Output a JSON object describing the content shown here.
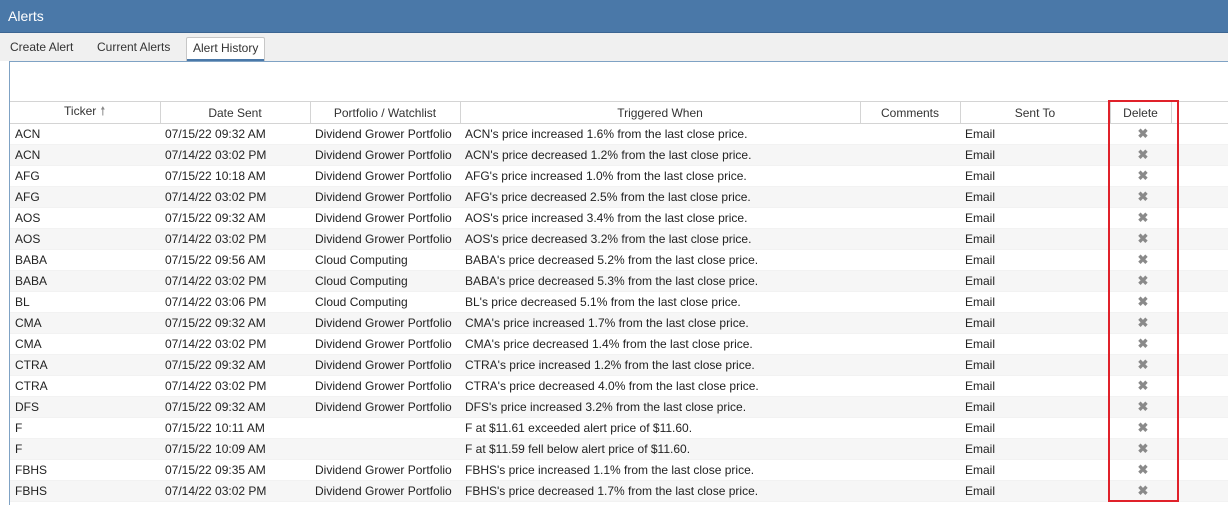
{
  "window": {
    "title": "Alerts"
  },
  "tabs": [
    {
      "label": "Create Alert"
    },
    {
      "label": "Current Alerts"
    },
    {
      "label": "Alert History"
    }
  ],
  "table": {
    "columns": [
      "Ticker",
      "Date Sent",
      "Portfolio / Watchlist",
      "Triggered When",
      "Comments",
      "Sent To",
      "Delete"
    ],
    "sort_icon": "arrow-up-icon",
    "delete_icon": "close-icon",
    "rows": [
      {
        "ticker": "ACN",
        "date": "07/15/22 09:32 AM",
        "portfolio": "Dividend Grower Portfolio",
        "triggered": "ACN's price increased 1.6% from the last close price.",
        "comments": "",
        "sent_to": "Email"
      },
      {
        "ticker": "ACN",
        "date": "07/14/22 03:02 PM",
        "portfolio": "Dividend Grower Portfolio",
        "triggered": "ACN's price decreased 1.2% from the last close price.",
        "comments": "",
        "sent_to": "Email"
      },
      {
        "ticker": "AFG",
        "date": "07/15/22 10:18 AM",
        "portfolio": "Dividend Grower Portfolio",
        "triggered": "AFG's price increased 1.0% from the last close price.",
        "comments": "",
        "sent_to": "Email"
      },
      {
        "ticker": "AFG",
        "date": "07/14/22 03:02 PM",
        "portfolio": "Dividend Grower Portfolio",
        "triggered": "AFG's price decreased 2.5% from the last close price.",
        "comments": "",
        "sent_to": "Email"
      },
      {
        "ticker": "AOS",
        "date": "07/15/22 09:32 AM",
        "portfolio": "Dividend Grower Portfolio",
        "triggered": "AOS's price increased 3.4% from the last close price.",
        "comments": "",
        "sent_to": "Email"
      },
      {
        "ticker": "AOS",
        "date": "07/14/22 03:02 PM",
        "portfolio": "Dividend Grower Portfolio",
        "triggered": "AOS's price decreased 3.2% from the last close price.",
        "comments": "",
        "sent_to": "Email"
      },
      {
        "ticker": "BABA",
        "date": "07/15/22 09:56 AM",
        "portfolio": "Cloud Computing",
        "triggered": "BABA's price decreased 5.2% from the last close price.",
        "comments": "",
        "sent_to": "Email"
      },
      {
        "ticker": "BABA",
        "date": "07/14/22 03:02 PM",
        "portfolio": "Cloud Computing",
        "triggered": "BABA's price decreased 5.3% from the last close price.",
        "comments": "",
        "sent_to": "Email"
      },
      {
        "ticker": "BL",
        "date": "07/14/22 03:06 PM",
        "portfolio": "Cloud Computing",
        "triggered": "BL's price decreased 5.1% from the last close price.",
        "comments": "",
        "sent_to": "Email"
      },
      {
        "ticker": "CMA",
        "date": "07/15/22 09:32 AM",
        "portfolio": "Dividend Grower Portfolio",
        "triggered": "CMA's price increased 1.7% from the last close price.",
        "comments": "",
        "sent_to": "Email"
      },
      {
        "ticker": "CMA",
        "date": "07/14/22 03:02 PM",
        "portfolio": "Dividend Grower Portfolio",
        "triggered": "CMA's price decreased 1.4% from the last close price.",
        "comments": "",
        "sent_to": "Email"
      },
      {
        "ticker": "CTRA",
        "date": "07/15/22 09:32 AM",
        "portfolio": "Dividend Grower Portfolio",
        "triggered": "CTRA's price increased 1.2% from the last close price.",
        "comments": "",
        "sent_to": "Email"
      },
      {
        "ticker": "CTRA",
        "date": "07/14/22 03:02 PM",
        "portfolio": "Dividend Grower Portfolio",
        "triggered": "CTRA's price decreased 4.0% from the last close price.",
        "comments": "",
        "sent_to": "Email"
      },
      {
        "ticker": "DFS",
        "date": "07/15/22 09:32 AM",
        "portfolio": "Dividend Grower Portfolio",
        "triggered": "DFS's price increased 3.2% from the last close price.",
        "comments": "",
        "sent_to": "Email"
      },
      {
        "ticker": "F",
        "date": "07/15/22 10:11 AM",
        "portfolio": "",
        "triggered": "F at $11.61 exceeded alert price of $11.60.",
        "comments": "",
        "sent_to": "Email"
      },
      {
        "ticker": "F",
        "date": "07/15/22 10:09 AM",
        "portfolio": "",
        "triggered": "F at $11.59 fell below alert price of $11.60.",
        "comments": "",
        "sent_to": "Email"
      },
      {
        "ticker": "FBHS",
        "date": "07/15/22 09:35 AM",
        "portfolio": "Dividend Grower Portfolio",
        "triggered": "FBHS's price increased 1.1% from the last close price.",
        "comments": "",
        "sent_to": "Email"
      },
      {
        "ticker": "FBHS",
        "date": "07/14/22 03:02 PM",
        "portfolio": "Dividend Grower Portfolio",
        "triggered": "FBHS's price decreased 1.7% from the last close price.",
        "comments": "",
        "sent_to": "Email"
      }
    ]
  },
  "highlight_color": "#e0212a",
  "accent_color": "#4a78a8"
}
